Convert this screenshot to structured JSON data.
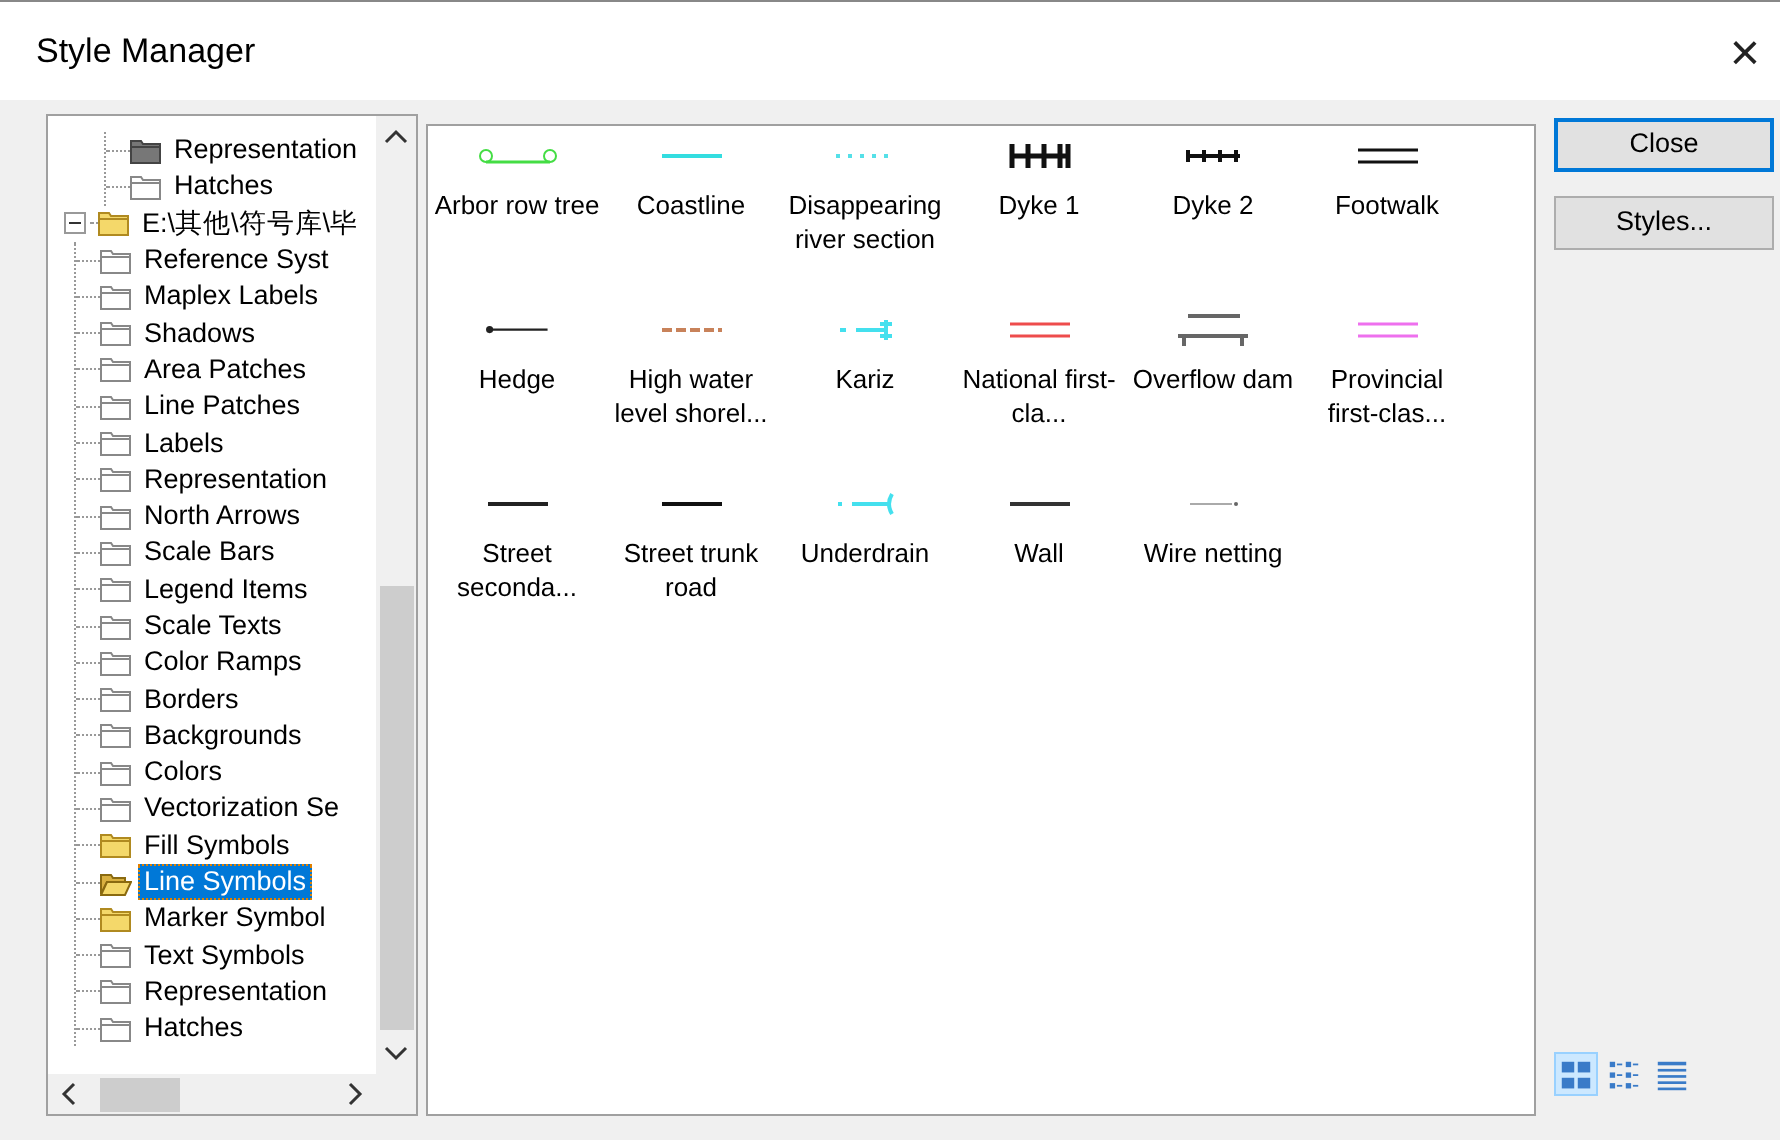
{
  "window": {
    "title": "Style Manager",
    "close": "×"
  },
  "tree": {
    "continued_children": [
      {
        "label": "Representation",
        "kind": "gray",
        "selected": false
      },
      {
        "label": "Hatches",
        "kind": "plain",
        "selected": false
      }
    ],
    "items": [
      {
        "label": "E:\\其他\\符号库\\毕",
        "kind": "yellow",
        "expanded": true,
        "selected": false,
        "children": [
          {
            "label": "Reference Syst",
            "kind": "plain",
            "selected": false
          },
          {
            "label": "Maplex Labels",
            "kind": "plain",
            "selected": false
          },
          {
            "label": "Shadows",
            "kind": "plain",
            "selected": false
          },
          {
            "label": "Area Patches",
            "kind": "plain",
            "selected": false
          },
          {
            "label": "Line Patches",
            "kind": "plain",
            "selected": false
          },
          {
            "label": "Labels",
            "kind": "plain",
            "selected": false
          },
          {
            "label": "Representation",
            "kind": "plain",
            "selected": false
          },
          {
            "label": "North Arrows",
            "kind": "plain",
            "selected": false
          },
          {
            "label": "Scale Bars",
            "kind": "plain",
            "selected": false
          },
          {
            "label": "Legend Items",
            "kind": "plain",
            "selected": false
          },
          {
            "label": "Scale Texts",
            "kind": "plain",
            "selected": false
          },
          {
            "label": "Color Ramps",
            "kind": "plain",
            "selected": false
          },
          {
            "label": "Borders",
            "kind": "plain",
            "selected": false
          },
          {
            "label": "Backgrounds",
            "kind": "plain",
            "selected": false
          },
          {
            "label": "Colors",
            "kind": "plain",
            "selected": false
          },
          {
            "label": "Vectorization Se",
            "kind": "plain",
            "selected": false
          },
          {
            "label": "Fill Symbols",
            "kind": "yellow",
            "selected": false
          },
          {
            "label": "Line Symbols",
            "kind": "open",
            "selected": true
          },
          {
            "label": "Marker Symbol",
            "kind": "yellow",
            "selected": false
          },
          {
            "label": "Text Symbols",
            "kind": "plain",
            "selected": false
          },
          {
            "label": "Representation",
            "kind": "plain",
            "selected": false
          },
          {
            "label": "Hatches",
            "kind": "plain",
            "selected": false
          }
        ]
      }
    ]
  },
  "symbols": [
    {
      "label": "Arbor row tree",
      "kind": "beads",
      "color": "#44dd44"
    },
    {
      "label": "Coastline",
      "kind": "solid",
      "color": "#33dde0"
    },
    {
      "label": "Disappearing river section",
      "kind": "dotted",
      "color": "#55e0e8"
    },
    {
      "label": "Dyke 1",
      "kind": "ticks-heavy",
      "color": "#111111"
    },
    {
      "label": "Dyke 2",
      "kind": "ticks",
      "color": "#111111"
    },
    {
      "label": "Footwalk",
      "kind": "double",
      "color": "#111111"
    },
    {
      "label": "Hedge",
      "kind": "dot-line",
      "color": "#222222"
    },
    {
      "label": "High water level shorel...",
      "kind": "dashed",
      "color": "#c8825a"
    },
    {
      "label": "Kariz",
      "kind": "kariz",
      "color": "#44e0ee"
    },
    {
      "label": "National first-cla...",
      "kind": "double",
      "color": "#ee4c4c"
    },
    {
      "label": "Overflow dam",
      "kind": "dam",
      "color": "#666666"
    },
    {
      "label": "Provincial first-clas...",
      "kind": "double",
      "color": "#ee70ee"
    },
    {
      "label": "Street seconda...",
      "kind": "solid",
      "color": "#222222"
    },
    {
      "label": "Street trunk road",
      "kind": "thick",
      "color": "#111111"
    },
    {
      "label": "Underdrain",
      "kind": "underdrain",
      "color": "#44e0ee"
    },
    {
      "label": "Wall",
      "kind": "solid",
      "color": "#333333"
    },
    {
      "label": "Wire netting",
      "kind": "wire",
      "color": "#aaaaaa"
    }
  ],
  "buttons": [
    {
      "label": "Close",
      "default": true
    },
    {
      "label": "Styles...",
      "default": false
    }
  ],
  "view_modes": [
    {
      "kind": "icons",
      "selected": true
    },
    {
      "kind": "list",
      "selected": false
    },
    {
      "kind": "details",
      "selected": false
    }
  ]
}
